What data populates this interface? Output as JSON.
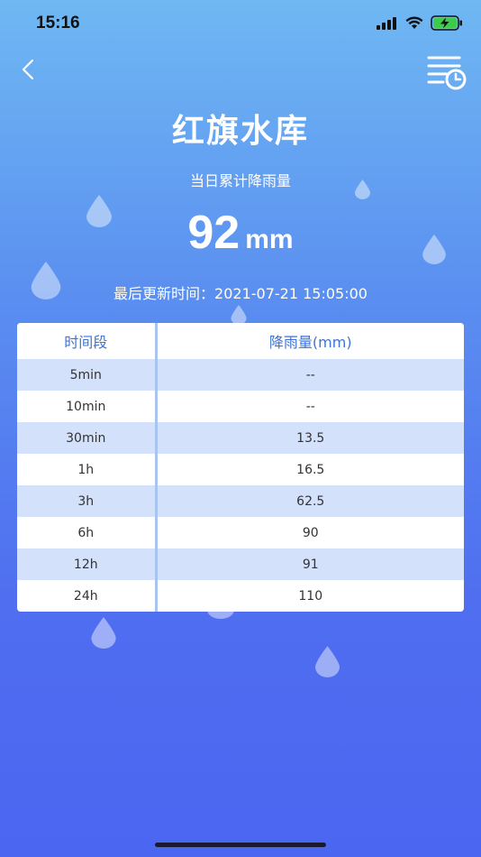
{
  "status_bar": {
    "time": "15:16"
  },
  "header": {
    "title": "红旗水库"
  },
  "summary": {
    "label": "当日累计降雨量",
    "value": "92",
    "unit": "mm",
    "update_text": "最后更新时间：2021-07-21 15:05:00"
  },
  "table": {
    "headers": [
      "时间段",
      "降雨量(mm)"
    ],
    "rows": [
      {
        "period": "5min",
        "rainfall": "--"
      },
      {
        "period": "10min",
        "rainfall": "--"
      },
      {
        "period": "30min",
        "rainfall": "13.5"
      },
      {
        "period": "1h",
        "rainfall": "16.5"
      },
      {
        "period": "3h",
        "rainfall": "62.5"
      },
      {
        "period": "6h",
        "rainfall": "90"
      },
      {
        "period": "12h",
        "rainfall": "91"
      },
      {
        "period": "24h",
        "rainfall": "110"
      }
    ]
  },
  "icons": {
    "back": "chevron-left-icon",
    "history": "list-clock-icon"
  },
  "colors": {
    "header_text": "#3d74d6",
    "row_alt": "#d3e1fb",
    "separator": "#a8c4f2"
  }
}
